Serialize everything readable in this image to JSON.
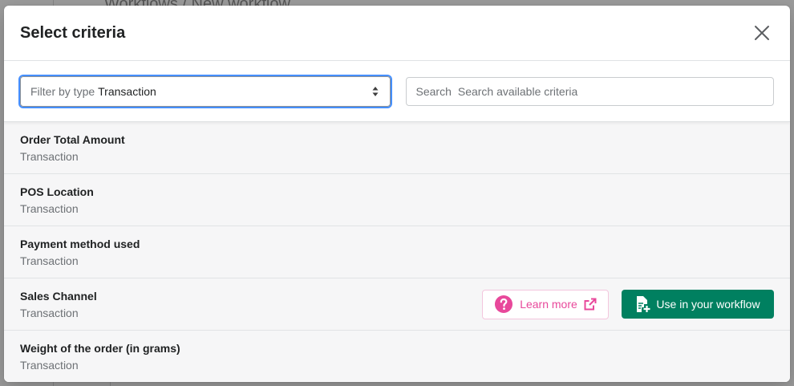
{
  "background": {
    "breadcrumb": "Workflows / New workflow"
  },
  "modal": {
    "title": "Select criteria",
    "filter": {
      "prefix": "Filter by type",
      "value": "Transaction"
    },
    "search": {
      "prefix": "Search",
      "placeholder": "Search available criteria"
    },
    "criteria": [
      {
        "name": "Order Total Amount",
        "type": "Transaction"
      },
      {
        "name": "POS Location",
        "type": "Transaction"
      },
      {
        "name": "Payment method used",
        "type": "Transaction"
      },
      {
        "name": "Sales Channel",
        "type": "Transaction"
      },
      {
        "name": "Weight of the order (in grams)",
        "type": "Transaction"
      }
    ],
    "actions": {
      "learn_more": "Learn more",
      "use": "Use in your workflow"
    }
  },
  "colors": {
    "accent_green": "#008060",
    "learn_pink": "#e8489b",
    "focus_blue": "#458fff"
  }
}
